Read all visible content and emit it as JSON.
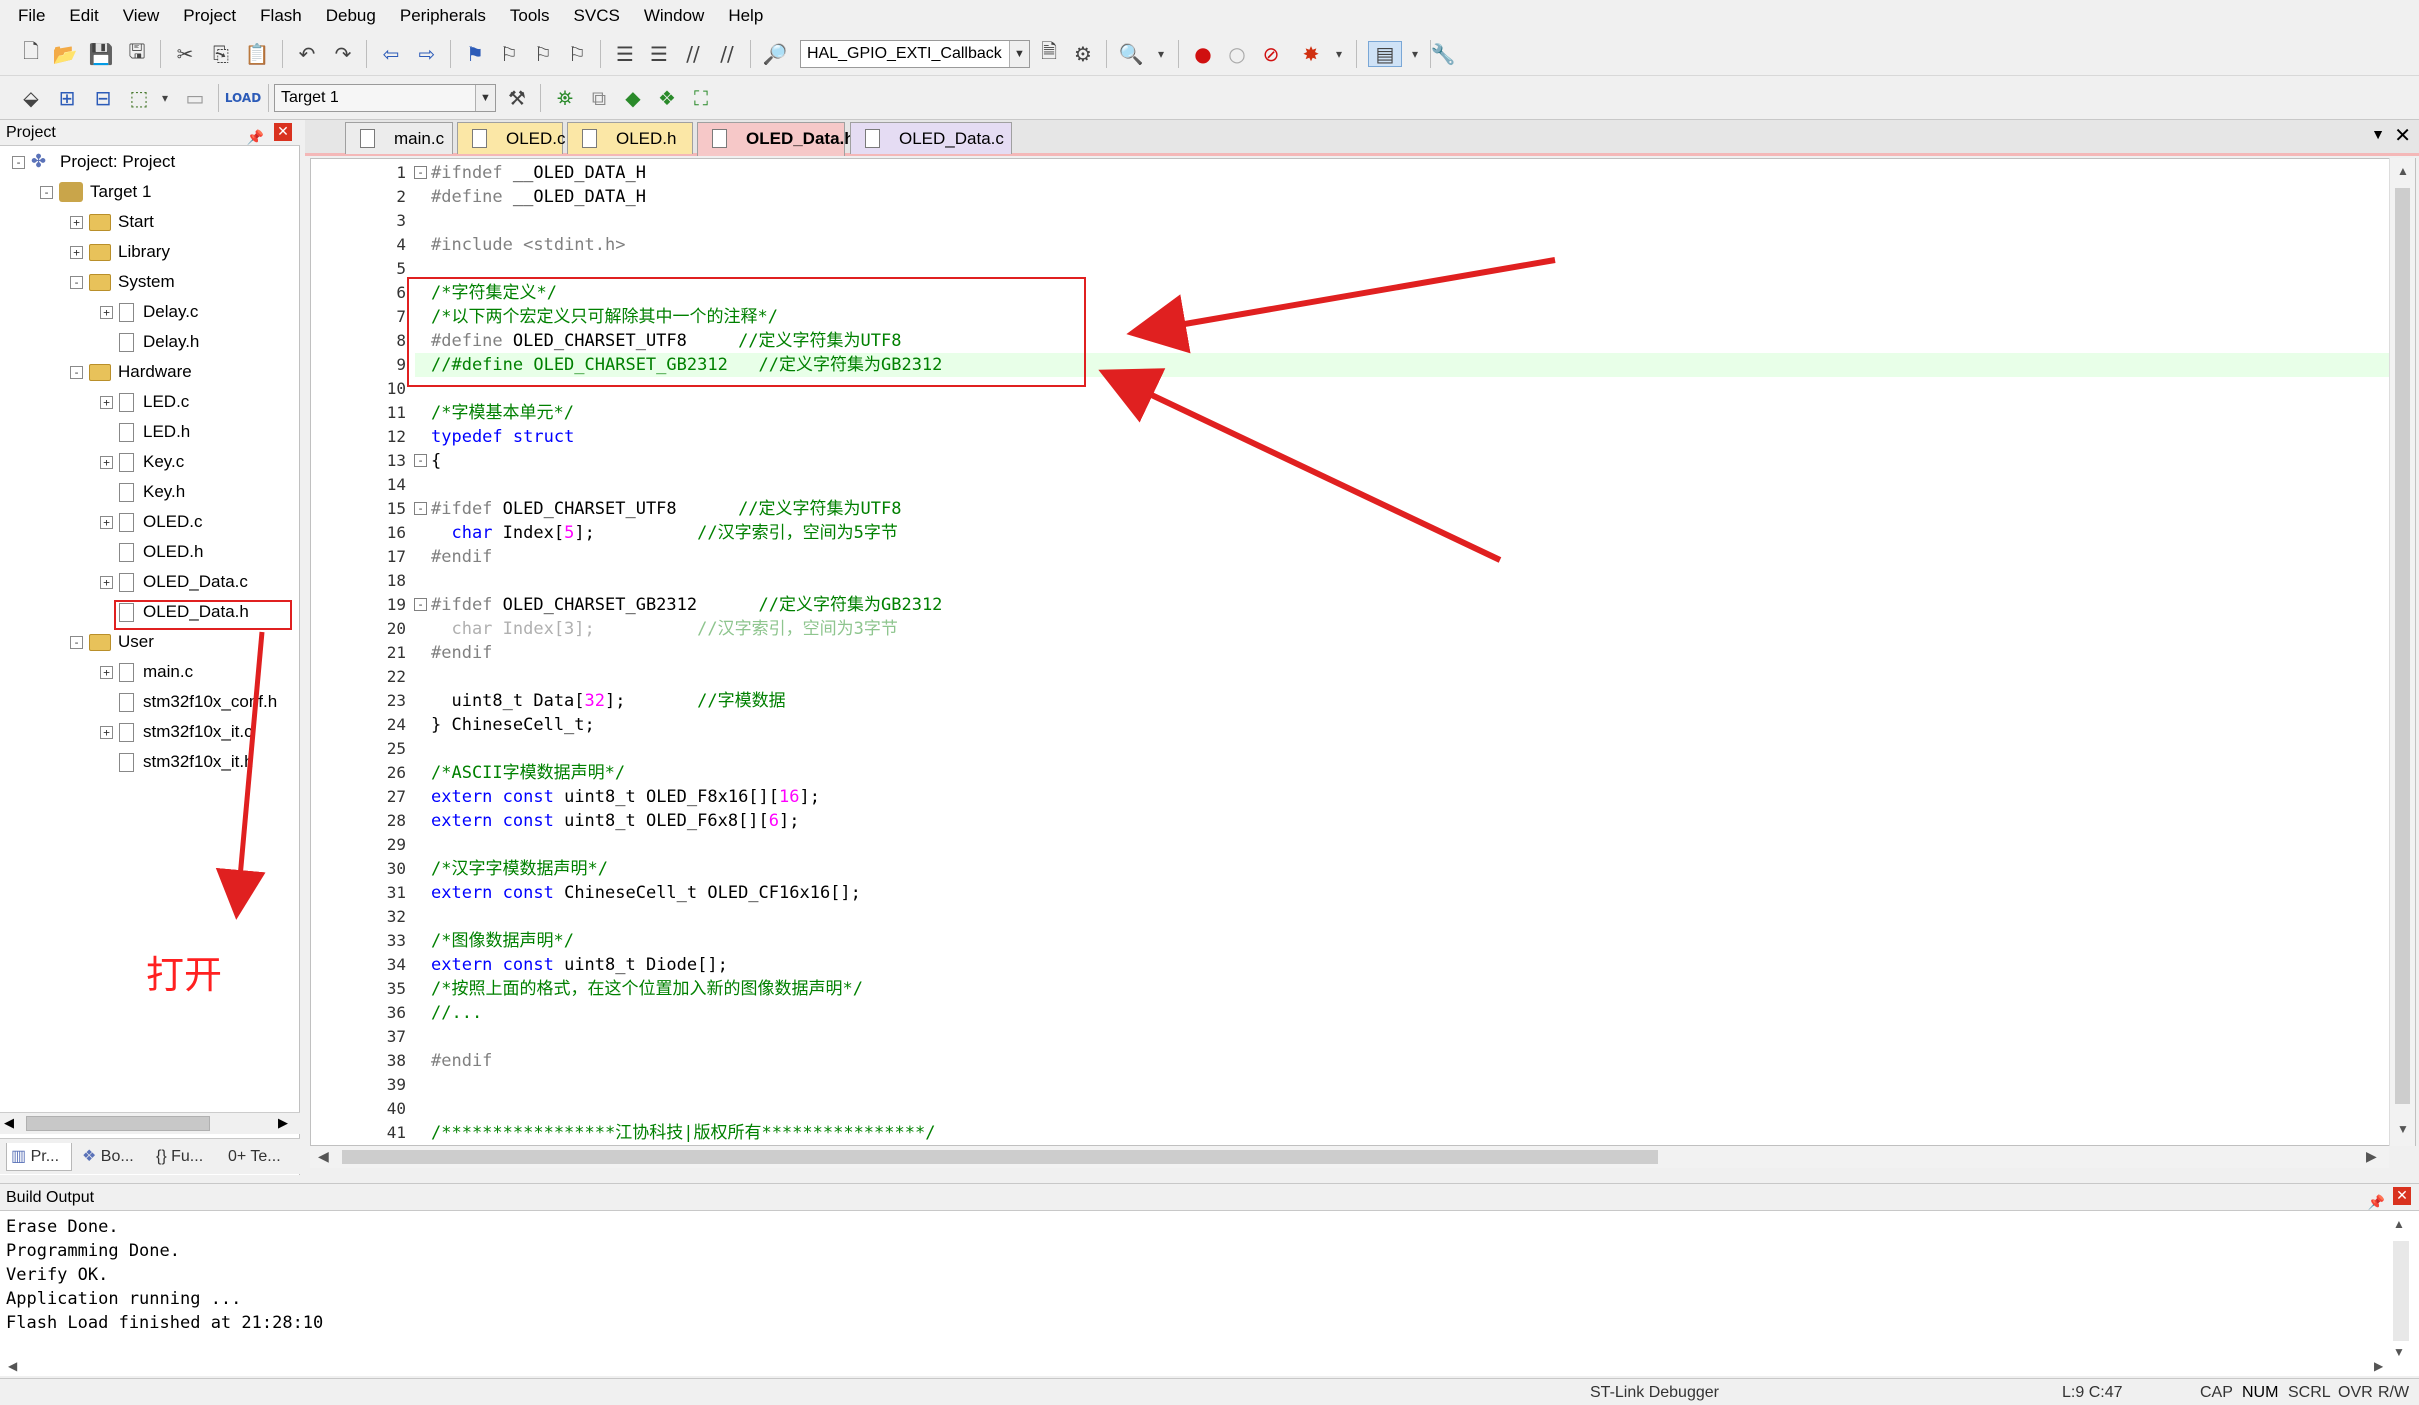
{
  "menu": [
    "File",
    "Edit",
    "View",
    "Project",
    "Flash",
    "Debug",
    "Peripherals",
    "Tools",
    "SVCS",
    "Window",
    "Help"
  ],
  "toolbar": {
    "find_combo": "HAL_GPIO_EXTI_Callback",
    "target_combo": "Target 1"
  },
  "project_panel": {
    "title": "Project",
    "tree": [
      {
        "label": "Project: Project",
        "level": 0,
        "type": "project",
        "exp": "-"
      },
      {
        "label": "Target 1",
        "level": 1,
        "type": "target",
        "exp": "-"
      },
      {
        "label": "Start",
        "level": 2,
        "type": "folder",
        "exp": "+"
      },
      {
        "label": "Library",
        "level": 2,
        "type": "folder",
        "exp": "+"
      },
      {
        "label": "System",
        "level": 2,
        "type": "folder",
        "exp": "-"
      },
      {
        "label": "Delay.c",
        "level": 3,
        "type": "file",
        "exp": "+"
      },
      {
        "label": "Delay.h",
        "level": 3,
        "type": "file",
        "exp": ""
      },
      {
        "label": "Hardware",
        "level": 2,
        "type": "folder",
        "exp": "-"
      },
      {
        "label": "LED.c",
        "level": 3,
        "type": "file",
        "exp": "+"
      },
      {
        "label": "LED.h",
        "level": 3,
        "type": "file",
        "exp": ""
      },
      {
        "label": "Key.c",
        "level": 3,
        "type": "file",
        "exp": "+"
      },
      {
        "label": "Key.h",
        "level": 3,
        "type": "file",
        "exp": ""
      },
      {
        "label": "OLED.c",
        "level": 3,
        "type": "file",
        "exp": "+"
      },
      {
        "label": "OLED.h",
        "level": 3,
        "type": "file",
        "exp": ""
      },
      {
        "label": "OLED_Data.c",
        "level": 3,
        "type": "file",
        "exp": "+"
      },
      {
        "label": "OLED_Data.h",
        "level": 3,
        "type": "file",
        "exp": ""
      },
      {
        "label": "User",
        "level": 2,
        "type": "folder",
        "exp": "-"
      },
      {
        "label": "main.c",
        "level": 3,
        "type": "file",
        "exp": "+"
      },
      {
        "label": "stm32f10x_conf.h",
        "level": 3,
        "type": "file",
        "exp": ""
      },
      {
        "label": "stm32f10x_it.c",
        "level": 3,
        "type": "file",
        "exp": "+"
      },
      {
        "label": "stm32f10x_it.h",
        "level": 3,
        "type": "file",
        "exp": ""
      }
    ],
    "bottom_tabs": [
      "Pr...",
      "Bo...",
      "{} Fu...",
      "0+ Te..."
    ]
  },
  "file_tabs": [
    {
      "label": "main.c",
      "bg": "#ececec"
    },
    {
      "label": "OLED.c",
      "bg": "#fbe7a6"
    },
    {
      "label": "OLED.h",
      "bg": "#fbe7a6"
    },
    {
      "label": "OLED_Data.h",
      "bg": "#f6c8c8"
    },
    {
      "label": "OLED_Data.c",
      "bg": "#e5dcf3"
    }
  ],
  "code": [
    {
      "fold": "-",
      "tokens": [
        [
          "pp",
          "#ifndef "
        ],
        [
          "tx",
          "__OLED_DATA_H"
        ]
      ]
    },
    {
      "fold": "",
      "tokens": [
        [
          "pp",
          "#define "
        ],
        [
          "tx",
          "__OLED_DATA_H"
        ]
      ]
    },
    {
      "fold": "",
      "tokens": []
    },
    {
      "fold": "",
      "tokens": [
        [
          "pp",
          "#include "
        ],
        [
          "pp",
          "<stdint.h>"
        ]
      ]
    },
    {
      "fold": "",
      "tokens": []
    },
    {
      "fold": "",
      "tokens": [
        [
          "cm",
          "/*字符集定义*/"
        ]
      ]
    },
    {
      "fold": "",
      "tokens": [
        [
          "cm",
          "/*以下两个宏定义只可解除其中一个的注释*/"
        ]
      ]
    },
    {
      "fold": "",
      "tokens": [
        [
          "pp",
          "#define "
        ],
        [
          "tx",
          "OLED_CHARSET_UTF8     "
        ],
        [
          "cm",
          "//定义字符集为UTF8"
        ]
      ]
    },
    {
      "fold": "",
      "tokens": [
        [
          "cm",
          "//#define OLED_CHARSET_GB2312   //定义字符集为GB2312"
        ]
      ]
    },
    {
      "fold": "",
      "tokens": []
    },
    {
      "fold": "",
      "tokens": [
        [
          "cm",
          "/*字模基本单元*/"
        ]
      ]
    },
    {
      "fold": "",
      "tokens": [
        [
          "kw",
          "typedef "
        ],
        [
          "kw",
          "struct"
        ]
      ]
    },
    {
      "fold": "-",
      "tokens": [
        [
          "tx",
          "{"
        ]
      ]
    },
    {
      "fold": "",
      "tokens": []
    },
    {
      "fold": "-",
      "tokens": [
        [
          "pp",
          "#ifdef "
        ],
        [
          "tx",
          "OLED_CHARSET_UTF8      "
        ],
        [
          "cm",
          "//定义字符集为UTF8"
        ]
      ]
    },
    {
      "fold": "",
      "tokens": [
        [
          "tx",
          "  "
        ],
        [
          "kw",
          "char "
        ],
        [
          "tx",
          "Index["
        ],
        [
          "nm",
          "5"
        ],
        [
          "tx",
          "];          "
        ],
        [
          "cm",
          "//汉字索引，空间为5字节"
        ]
      ]
    },
    {
      "fold": "",
      "tokens": [
        [
          "pp",
          "#endif"
        ]
      ]
    },
    {
      "fold": "",
      "tokens": []
    },
    {
      "fold": "-",
      "tokens": [
        [
          "pp",
          "#ifdef "
        ],
        [
          "tx",
          "OLED_CHARSET_GB2312      "
        ],
        [
          "cm",
          "//定义字符集为GB2312"
        ]
      ]
    },
    {
      "fold": "",
      "tokens": [
        [
          "gr",
          "  char Index[3];          "
        ],
        [
          "gc",
          "//汉字索引，空间为3字节"
        ]
      ]
    },
    {
      "fold": "",
      "tokens": [
        [
          "pp",
          "#endif"
        ]
      ]
    },
    {
      "fold": "",
      "tokens": []
    },
    {
      "fold": "",
      "tokens": [
        [
          "tx",
          "  uint8_t Data["
        ],
        [
          "nm",
          "32"
        ],
        [
          "tx",
          "];       "
        ],
        [
          "cm",
          "//字模数据"
        ]
      ]
    },
    {
      "fold": "",
      "tokens": [
        [
          "tx",
          "} ChineseCell_t;"
        ]
      ]
    },
    {
      "fold": "",
      "tokens": []
    },
    {
      "fold": "",
      "tokens": [
        [
          "cm",
          "/*ASCII字模数据声明*/"
        ]
      ]
    },
    {
      "fold": "",
      "tokens": [
        [
          "kw",
          "extern "
        ],
        [
          "kw",
          "const "
        ],
        [
          "tx",
          "uint8_t OLED_F8x16[]["
        ],
        [
          "nm",
          "16"
        ],
        [
          "tx",
          "];"
        ]
      ]
    },
    {
      "fold": "",
      "tokens": [
        [
          "kw",
          "extern "
        ],
        [
          "kw",
          "const "
        ],
        [
          "tx",
          "uint8_t OLED_F6x8[]["
        ],
        [
          "nm",
          "6"
        ],
        [
          "tx",
          "];"
        ]
      ]
    },
    {
      "fold": "",
      "tokens": []
    },
    {
      "fold": "",
      "tokens": [
        [
          "cm",
          "/*汉字字模数据声明*/"
        ]
      ]
    },
    {
      "fold": "",
      "tokens": [
        [
          "kw",
          "extern "
        ],
        [
          "kw",
          "const "
        ],
        [
          "tx",
          "ChineseCell_t OLED_CF16x16[];"
        ]
      ]
    },
    {
      "fold": "",
      "tokens": []
    },
    {
      "fold": "",
      "tokens": [
        [
          "cm",
          "/*图像数据声明*/"
        ]
      ]
    },
    {
      "fold": "",
      "tokens": [
        [
          "kw",
          "extern "
        ],
        [
          "kw",
          "const "
        ],
        [
          "tx",
          "uint8_t Diode[];"
        ]
      ]
    },
    {
      "fold": "",
      "tokens": [
        [
          "cm",
          "/*按照上面的格式，在这个位置加入新的图像数据声明*/"
        ]
      ]
    },
    {
      "fold": "",
      "tokens": [
        [
          "cm",
          "//..."
        ]
      ]
    },
    {
      "fold": "",
      "tokens": []
    },
    {
      "fold": "",
      "tokens": [
        [
          "pp",
          "#endif"
        ]
      ]
    },
    {
      "fold": "",
      "tokens": []
    },
    {
      "fold": "",
      "tokens": []
    },
    {
      "fold": "",
      "tokens": [
        [
          "cm",
          "/*****************江协科技|版权所有****************/"
        ]
      ]
    }
  ],
  "build_output": {
    "title": "Build Output",
    "lines": [
      "Erase Done.",
      "Programming Done.",
      "Verify OK.",
      "Application running ...",
      "Flash Load finished at 21:28:10"
    ]
  },
  "status": {
    "debugger": "ST-Link Debugger",
    "position": "L:9 C:47",
    "flags": [
      "CAP",
      "NUM",
      "SCRL",
      "OVR",
      "R/W"
    ]
  },
  "annotation": {
    "text": "打开",
    "color": "#ff2020"
  }
}
